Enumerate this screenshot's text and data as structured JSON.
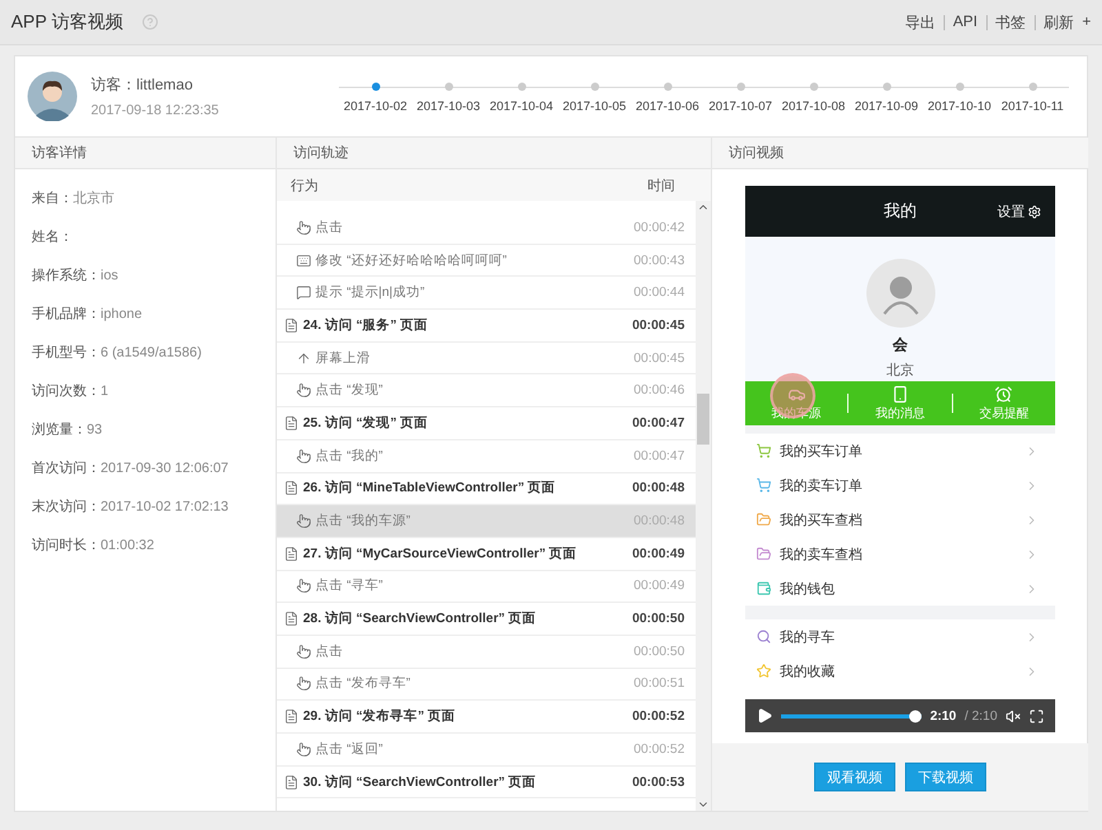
{
  "header": {
    "title": "APP 访客视频",
    "links": [
      "导出",
      "API",
      "书签",
      "刷新"
    ],
    "add": "+"
  },
  "visitor": {
    "name": "访客：littlemao",
    "time": "2017-09-18 12:23:35"
  },
  "timeline": [
    {
      "date": "2017-10-02",
      "selected": true
    },
    {
      "date": "2017-10-03",
      "selected": false
    },
    {
      "date": "2017-10-04",
      "selected": false
    },
    {
      "date": "2017-10-05",
      "selected": false
    },
    {
      "date": "2017-10-06",
      "selected": false
    },
    {
      "date": "2017-10-07",
      "selected": false
    },
    {
      "date": "2017-10-08",
      "selected": false
    },
    {
      "date": "2017-10-09",
      "selected": false
    },
    {
      "date": "2017-10-10",
      "selected": false
    },
    {
      "date": "2017-10-11",
      "selected": false
    }
  ],
  "details": {
    "title": "访客详情",
    "fields": [
      {
        "label": "来自：",
        "value": "北京市"
      },
      {
        "label": "姓名："
      },
      {
        "label": "操作系统：",
        "value": "ios"
      },
      {
        "label": "手机品牌：",
        "value": "iphone"
      },
      {
        "label": "手机型号：",
        "value": "6 (a1549/a1586)"
      },
      {
        "label": "访问次数：",
        "value": "1"
      },
      {
        "label": "浏览量：",
        "value": "93"
      },
      {
        "label": "首次访问：",
        "value": "2017-09-30 12:06:07"
      },
      {
        "label": "末次访问：",
        "value": "2017-10-02 17:02:13"
      },
      {
        "label": "访问时长：",
        "value": "01:00:32"
      }
    ]
  },
  "track": {
    "title": "访问轨迹",
    "columns": [
      "行为",
      "时间"
    ],
    "rows": [
      {
        "kind": "click",
        "text": "点击",
        "time": "00:00:42",
        "selected": false
      },
      {
        "kind": "edit",
        "text": "修改 “还好还好哈哈哈哈呵呵呵”",
        "time": "00:00:43",
        "selected": false
      },
      {
        "kind": "tip",
        "text": "提示 “提示|n|成功”",
        "time": "00:00:44",
        "selected": false
      },
      {
        "kind": "page",
        "text": "24. 访问 “服务” 页面",
        "time": "00:00:45",
        "selected": false
      },
      {
        "kind": "swipe",
        "text": "屏幕上滑",
        "time": "00:00:45",
        "selected": false
      },
      {
        "kind": "click",
        "text": "点击 “发现”",
        "time": "00:00:46",
        "selected": false
      },
      {
        "kind": "page",
        "text": "25. 访问 “发现” 页面",
        "time": "00:00:47",
        "selected": false
      },
      {
        "kind": "click",
        "text": "点击 “我的”",
        "time": "00:00:47",
        "selected": false
      },
      {
        "kind": "page",
        "text": "26. 访问 “MineTableViewController” 页面",
        "time": "00:00:48",
        "selected": false
      },
      {
        "kind": "click",
        "text": "点击 “我的车源”",
        "time": "00:00:48",
        "selected": true
      },
      {
        "kind": "page",
        "text": "27. 访问 “MyCarSourceViewController” 页面",
        "time": "00:00:49",
        "selected": false
      },
      {
        "kind": "click",
        "text": "点击 “寻车”",
        "time": "00:00:49",
        "selected": false
      },
      {
        "kind": "page",
        "text": "28. 访问 “SearchViewController” 页面",
        "time": "00:00:50",
        "selected": false
      },
      {
        "kind": "click",
        "text": "点击",
        "time": "00:00:50",
        "selected": false
      },
      {
        "kind": "click",
        "text": "点击 “发布寻车”",
        "time": "00:00:51",
        "selected": false
      },
      {
        "kind": "page",
        "text": "29. 访问 “发布寻车” 页面",
        "time": "00:00:52",
        "selected": false
      },
      {
        "kind": "click",
        "text": "点击 “返回”",
        "time": "00:00:52",
        "selected": false
      },
      {
        "kind": "page",
        "text": "30. 访问 “SearchViewController” 页面",
        "time": "00:00:53",
        "selected": false
      }
    ]
  },
  "video": {
    "title": "访问视频",
    "phone": {
      "title": "我的",
      "settings": "设置",
      "name": "会",
      "city": "北京",
      "shortcuts": [
        "我的车源",
        "我的消息",
        "交易提醒"
      ],
      "menu_groups": [
        {
          "items": [
            {
              "label": "我的买车订单",
              "color": "#8cc63f"
            },
            {
              "label": "我的卖车订单",
              "color": "#5bb8e8"
            },
            {
              "label": "我的买车查档",
              "color": "#f0a94a"
            },
            {
              "label": "我的卖车查档",
              "color": "#c38ad0"
            },
            {
              "label": "我的钱包",
              "color": "#3cc7b0"
            }
          ]
        },
        {
          "items": [
            {
              "label": "我的寻车",
              "color": "#9a7fd0"
            },
            {
              "label": "我的收藏",
              "color": "#f2c530"
            }
          ]
        }
      ]
    },
    "player": {
      "level": 1,
      "current": "2:10",
      "total": "/ 2:10"
    },
    "buttons": [
      "观看视频",
      "下载视频"
    ]
  }
}
